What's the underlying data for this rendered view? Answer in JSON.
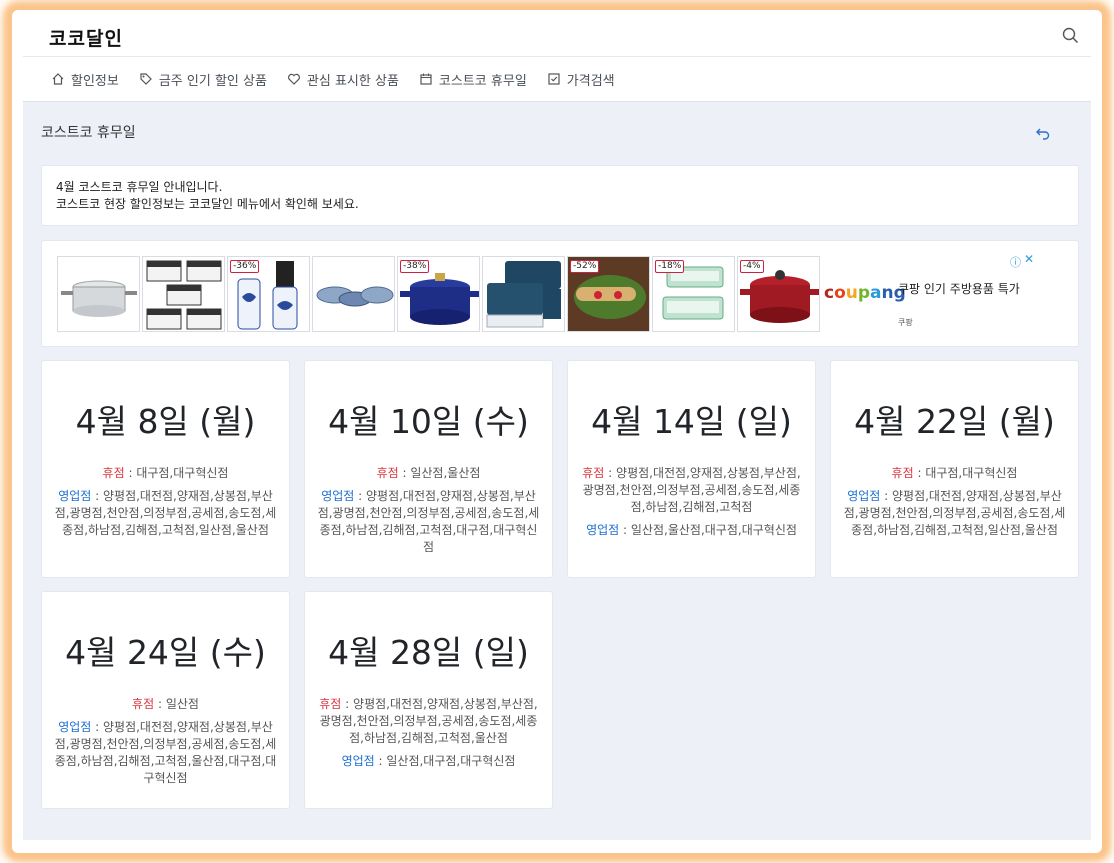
{
  "app": {
    "logo": "코코달인"
  },
  "nav": [
    {
      "label": "할인정보",
      "icon": "home-icon"
    },
    {
      "label": "금주 인기 할인 상품",
      "icon": "tag-icon"
    },
    {
      "label": "관심 표시한 상품",
      "icon": "heart-icon"
    },
    {
      "label": "코스트코 휴무일",
      "icon": "calendar-icon"
    },
    {
      "label": "가격검색",
      "icon": "checkbox-icon"
    }
  ],
  "page": {
    "title": "코스트코 휴무일"
  },
  "notice": {
    "line1": "4월 코스트코 휴무일 안내입니다.",
    "line2": "코스트코 현장 할인정보는 코코달인 메뉴에서 확인해 보세요."
  },
  "ad": {
    "products": [
      {
        "name": "stainless-pot",
        "discount": ""
      },
      {
        "name": "storage-containers",
        "discount": ""
      },
      {
        "name": "pepper-grinders",
        "discount": "-36%"
      },
      {
        "name": "ceramic-dishes",
        "discount": ""
      },
      {
        "name": "blue-dutch-oven",
        "discount": "-38%"
      },
      {
        "name": "navy-bins",
        "discount": ""
      },
      {
        "name": "food-platter",
        "discount": "-52%"
      },
      {
        "name": "mint-containers",
        "discount": "-18%"
      },
      {
        "name": "red-dutch-oven",
        "discount": "-4%"
      }
    ],
    "brand": "coupang",
    "text": "쿠팡 인기 주방용품 특가",
    "sub": "쿠팡",
    "colors": {
      "brand_red": "#b1281e",
      "brand_blue": "#2a5db0"
    }
  },
  "labels": {
    "closed": "휴점",
    "open": "영업점",
    "sep": " : "
  },
  "holidays": [
    {
      "date": "4월 8일 (월)",
      "closed": "대구점,대구혁신점",
      "open": "양평점,대전점,양재점,상봉점,부산점,광명점,천안점,의정부점,공세점,송도점,세종점,하남점,김해점,고척점,일산점,울산점"
    },
    {
      "date": "4월 10일 (수)",
      "closed": "일산점,울산점",
      "open": "양평점,대전점,양재점,상봉점,부산점,광명점,천안점,의정부점,공세점,송도점,세종점,하남점,김해점,고척점,대구점,대구혁신점"
    },
    {
      "date": "4월 14일 (일)",
      "closed": "양평점,대전점,양재점,상봉점,부산점,광명점,천안점,의정부점,공세점,송도점,세종점,하남점,김해점,고척점",
      "open": "일산점,울산점,대구점,대구혁신점"
    },
    {
      "date": "4월 22일 (월)",
      "closed": "대구점,대구혁신점",
      "open": "양평점,대전점,양재점,상봉점,부산점,광명점,천안점,의정부점,공세점,송도점,세종점,하남점,김해점,고척점,일산점,울산점"
    },
    {
      "date": "4월 24일 (수)",
      "closed": "일산점",
      "open": "양평점,대전점,양재점,상봉점,부산점,광명점,천안점,의정부점,공세점,송도점,세종점,하남점,김해점,고척점,울산점,대구점,대구혁신점"
    },
    {
      "date": "4월 28일 (일)",
      "closed": "양평점,대전점,양재점,상봉점,부산점,광명점,천안점,의정부점,공세점,송도점,세종점,하남점,김해점,고척점,울산점",
      "open": "일산점,대구점,대구혁신점"
    }
  ]
}
